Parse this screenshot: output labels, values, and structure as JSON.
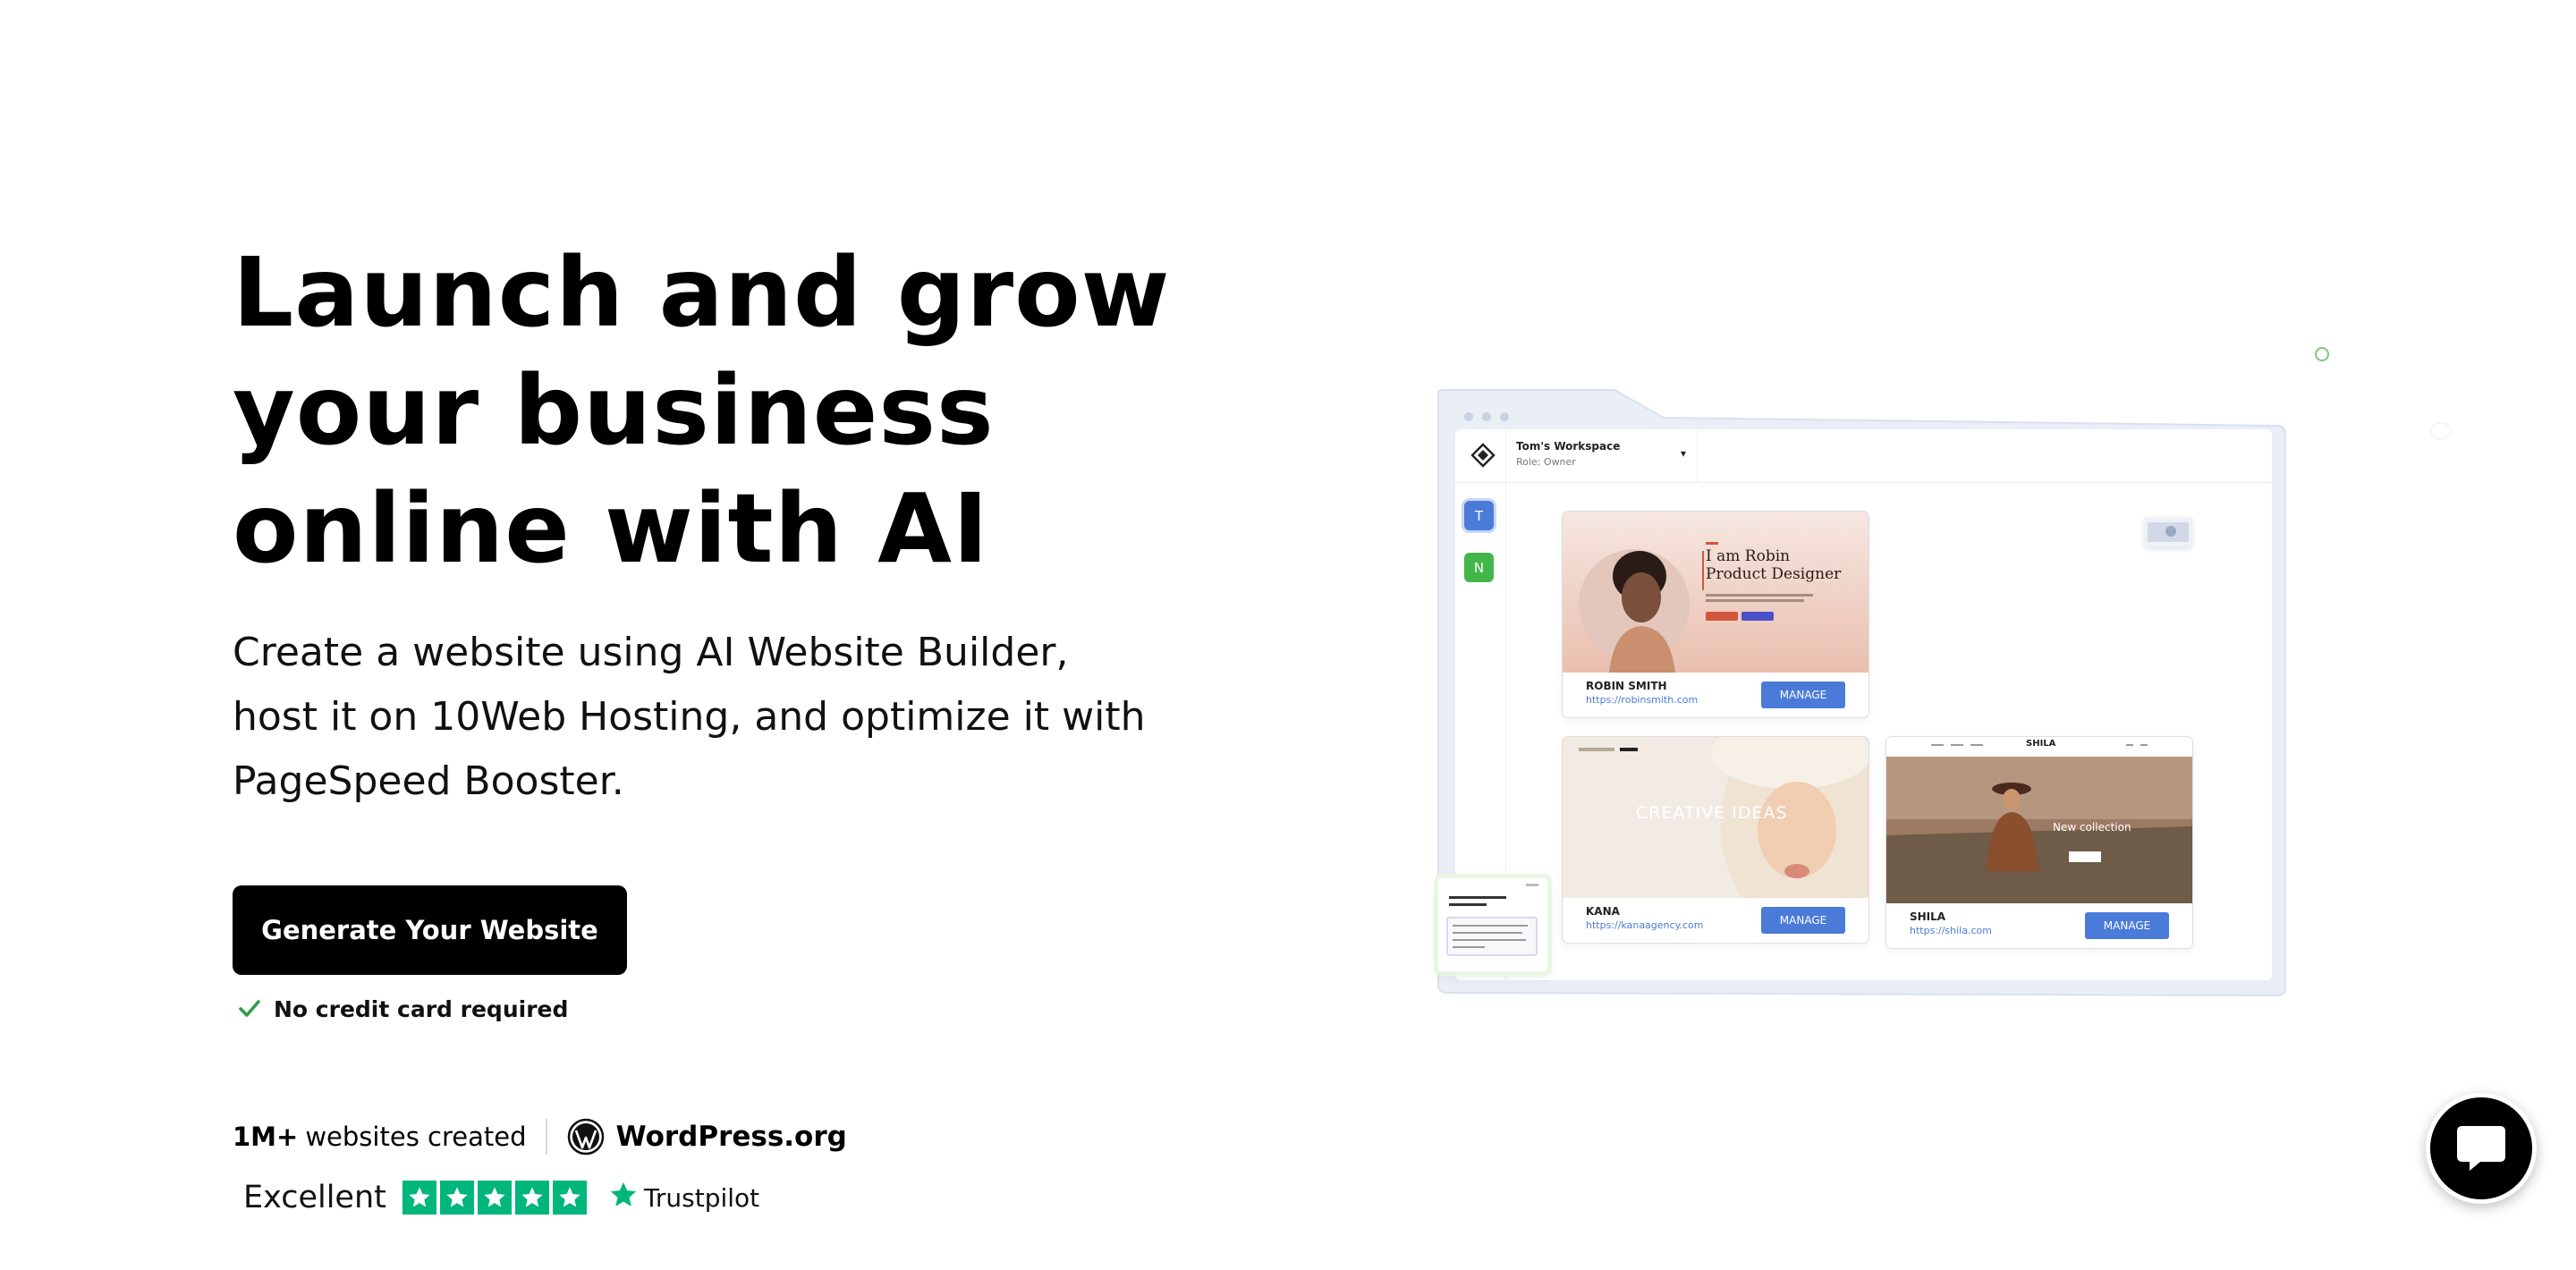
{
  "hero": {
    "title_lines": [
      "Launch and grow",
      "your business",
      "online with AI"
    ],
    "subtitle_lines": [
      "Create a website using AI Website Builder,",
      "host it on 10Web Hosting, and optimize it with",
      "PageSpeed Booster."
    ],
    "cta_label": "Generate Your Website",
    "no_credit_card": "No credit card required"
  },
  "stats": {
    "count": "1M+",
    "count_label": "websites created",
    "partner": "WordPress.org"
  },
  "trustpilot": {
    "rating_word": "Excellent",
    "stars": 5,
    "brand": "Trustpilot",
    "star_color": "#00b67a"
  },
  "dashboard": {
    "workspace_name": "Tom's Workspace",
    "workspace_role": "Role: Owner",
    "avatars": [
      "T",
      "N"
    ],
    "sites": [
      {
        "name": "ROBIN SMITH",
        "url": "https://robinsmith.com",
        "button": "MANAGE",
        "preview_lines": [
          "I am Robin",
          "Product Designer"
        ]
      },
      {
        "name": "KANA",
        "url": "https://kanaagency.com",
        "button": "MANAGE",
        "preview_text": "CREATIVE IDEAS"
      },
      {
        "name": "SHILA",
        "url": "https://shila.com",
        "button": "MANAGE",
        "preview_brand": "SHILA",
        "preview_text": "New collection"
      }
    ]
  },
  "colors": {
    "primary_blue": "#4a7bd9",
    "green": "#43b649",
    "cta_bg": "#000000"
  },
  "chat": {
    "icon": "chat-bubble-icon"
  }
}
